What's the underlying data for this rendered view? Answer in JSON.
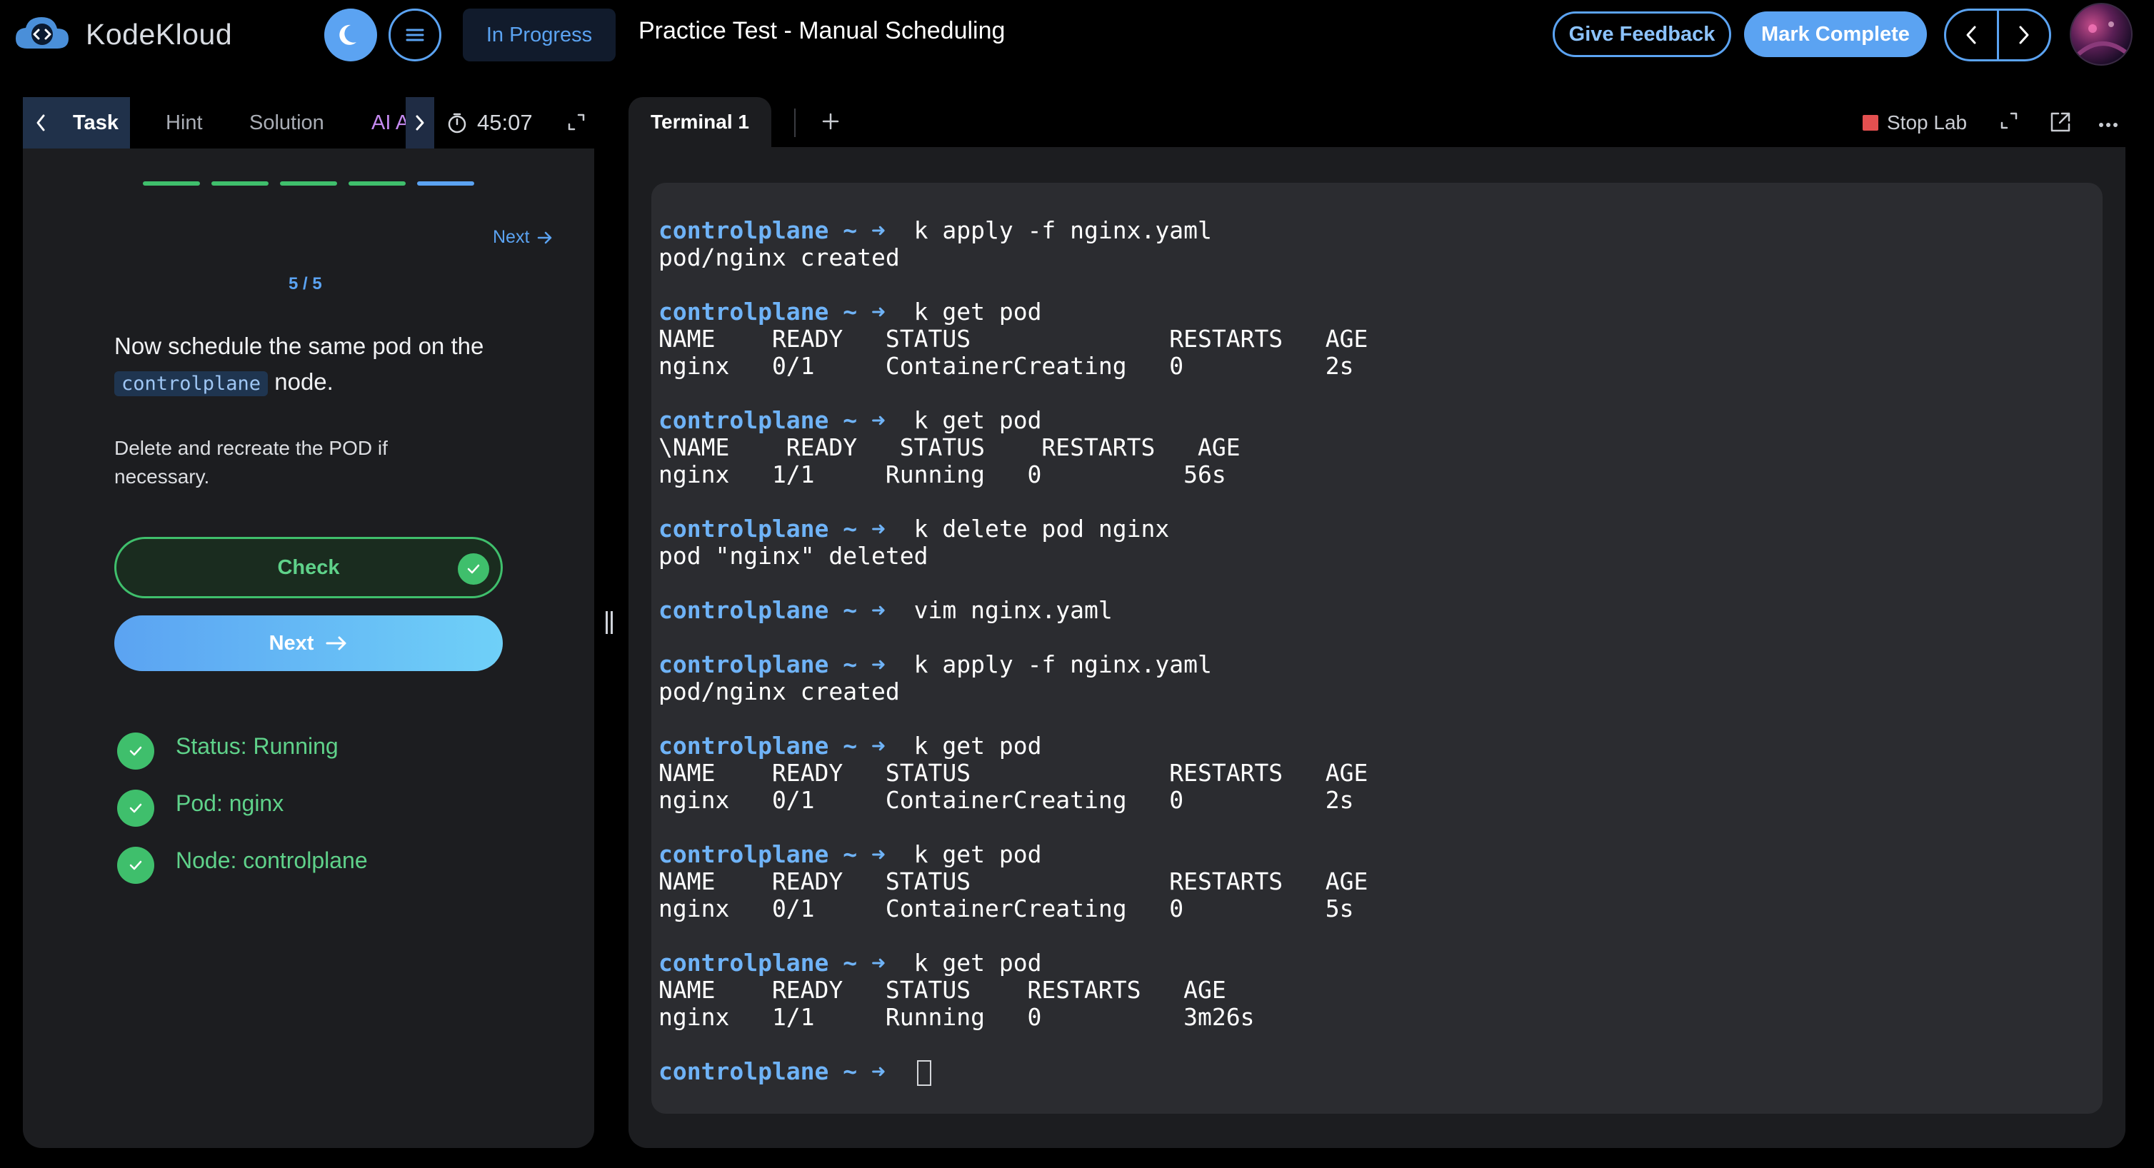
{
  "header": {
    "brand": "KodeKloud",
    "status": "In Progress",
    "title": "Practice Test - Manual Scheduling",
    "feedback_label": "Give Feedback",
    "complete_label": "Mark Complete",
    "accent": "#5ba3f2"
  },
  "left": {
    "tabs": [
      "Task",
      "Hint",
      "Solution",
      "AI Assis"
    ],
    "timer": "45:07",
    "steps_total": 5,
    "steps_done": 4,
    "next_link": "Next",
    "counter": "5 / 5",
    "question_before": "Now schedule the same pod on the",
    "question_code": "controlplane",
    "question_after": "node.",
    "subtext": "Delete and recreate the POD if necessary.",
    "check_label": "Check",
    "next_label": "Next",
    "statuses": [
      "Status: Running",
      "Pod: nginx",
      "Node: controlplane"
    ]
  },
  "terminal": {
    "tab_label": "Terminal 1",
    "stop_label": "Stop Lab",
    "prompt": "controlplane ~ ➜",
    "blocks": [
      {
        "cmd": "k apply -f nginx.yaml",
        "out": [
          "pod/nginx created"
        ]
      },
      {
        "cmd": "k get pod",
        "out": [
          "NAME    READY   STATUS              RESTARTS   AGE",
          "nginx   0/1     ContainerCreating   0          2s"
        ]
      },
      {
        "cmd": "k get pod",
        "out": [
          "\\NAME    READY   STATUS    RESTARTS   AGE",
          "nginx   1/1     Running   0          56s"
        ]
      },
      {
        "cmd": "k delete pod nginx",
        "out": [
          "pod \"nginx\" deleted"
        ]
      },
      {
        "cmd": "vim nginx.yaml",
        "out": []
      },
      {
        "cmd": "k apply -f nginx.yaml",
        "out": [
          "pod/nginx created"
        ]
      },
      {
        "cmd": "k get pod",
        "out": [
          "NAME    READY   STATUS              RESTARTS   AGE",
          "nginx   0/1     ContainerCreating   0          2s"
        ]
      },
      {
        "cmd": "k get pod",
        "out": [
          "NAME    READY   STATUS              RESTARTS   AGE",
          "nginx   0/1     ContainerCreating   0          5s"
        ]
      },
      {
        "cmd": "k get pod",
        "out": [
          "NAME    READY   STATUS    RESTARTS   AGE",
          "nginx   1/1     Running   0          3m26s"
        ]
      }
    ]
  }
}
